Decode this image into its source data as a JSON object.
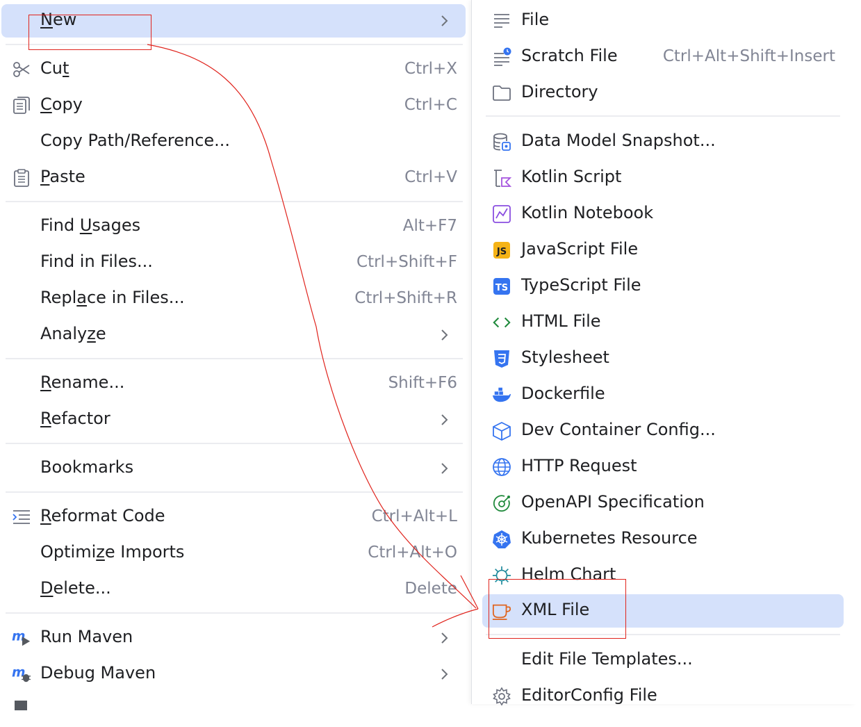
{
  "main_menu": {
    "new": {
      "pre": "",
      "ul": "N",
      "post": "ew"
    },
    "cut": {
      "pre": "Cu",
      "ul": "t",
      "post": "",
      "shortcut": "Ctrl+X"
    },
    "copy": {
      "pre": "",
      "ul": "C",
      "post": "opy",
      "shortcut": "Ctrl+C"
    },
    "copy_path": {
      "label": "Copy Path/Reference..."
    },
    "paste": {
      "pre": "",
      "ul": "P",
      "post": "aste",
      "shortcut": "Ctrl+V"
    },
    "find_usages": {
      "pre": "Find ",
      "ul": "U",
      "post": "sages",
      "shortcut": "Alt+F7"
    },
    "find_in_files": {
      "label": "Find in Files...",
      "shortcut": "Ctrl+Shift+F"
    },
    "replace_in_files": {
      "pre": "Repl",
      "ul": "a",
      "post": "ce in Files...",
      "shortcut": "Ctrl+Shift+R"
    },
    "analyze": {
      "pre": "Analy",
      "ul": "z",
      "post": "e"
    },
    "rename": {
      "pre": "",
      "ul": "R",
      "post": "ename...",
      "shortcut": "Shift+F6"
    },
    "refactor": {
      "pre": "",
      "ul": "R",
      "post": "efactor"
    },
    "bookmarks": {
      "label": "Bookmarks"
    },
    "reformat_code": {
      "pre": "",
      "ul": "R",
      "post": "eformat Code",
      "shortcut": "Ctrl+Alt+L"
    },
    "optimize_imports": {
      "pre": "Optimi",
      "ul": "z",
      "post": "e Imports",
      "shortcut": "Ctrl+Alt+O"
    },
    "delete": {
      "pre": "",
      "ul": "D",
      "post": "elete...",
      "shortcut": "Delete"
    },
    "run_maven": {
      "label": "Run Maven"
    },
    "debug_maven": {
      "label": "Debug Maven"
    }
  },
  "sub_menu": {
    "items": [
      {
        "label": "File"
      },
      {
        "label": "Scratch File",
        "shortcut": "Ctrl+Alt+Shift+Insert"
      },
      {
        "label": "Directory"
      },
      {
        "label": "Data Model Snapshot..."
      },
      {
        "label": "Kotlin Script"
      },
      {
        "label": "Kotlin Notebook"
      },
      {
        "label": "JavaScript File",
        "badge": "JS"
      },
      {
        "label": "TypeScript File",
        "badge": "TS"
      },
      {
        "label": "HTML File"
      },
      {
        "label": "Stylesheet"
      },
      {
        "label": "Dockerfile"
      },
      {
        "label": "Dev Container Config..."
      },
      {
        "label": "HTTP Request"
      },
      {
        "label": "OpenAPI Specification"
      },
      {
        "label": "Kubernetes Resource"
      },
      {
        "label": "Helm Chart"
      },
      {
        "label": "XML File"
      },
      {
        "label": "Edit File Templates..."
      },
      {
        "label": "EditorConfig File"
      }
    ],
    "selected": "XML File"
  },
  "colors": {
    "selection": "#d5e1fb",
    "annotation": "#e0231c",
    "shortcut_text": "#818594",
    "js_badge": "#f5b316",
    "ts_badge": "#3574f0"
  }
}
